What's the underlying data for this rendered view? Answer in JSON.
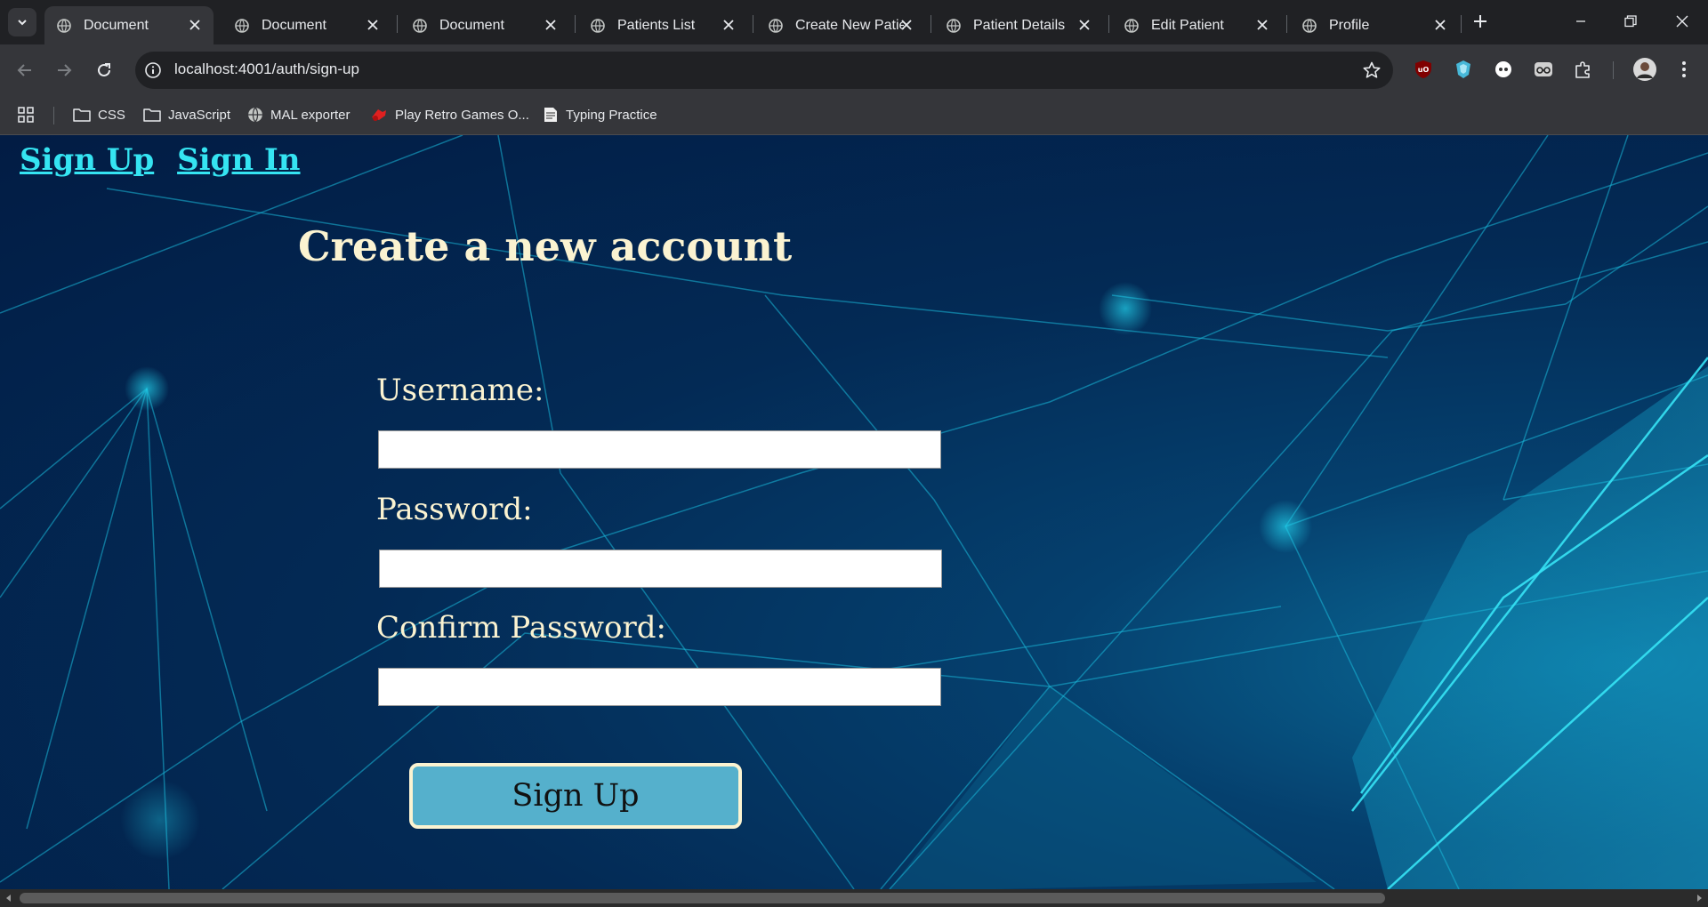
{
  "browser": {
    "tabs": [
      {
        "title": "Document",
        "active": true
      },
      {
        "title": "Document",
        "active": false
      },
      {
        "title": "Document",
        "active": false
      },
      {
        "title": "Patients List",
        "active": false
      },
      {
        "title": "Create New Patie",
        "active": false
      },
      {
        "title": "Patient Details",
        "active": false
      },
      {
        "title": "Edit Patient",
        "active": false
      },
      {
        "title": "Profile",
        "active": false
      }
    ],
    "url": "localhost:4001/auth/sign-up",
    "bookmarks": [
      {
        "label": "CSS",
        "icon": "folder-icon"
      },
      {
        "label": "JavaScript",
        "icon": "folder-icon"
      },
      {
        "label": "MAL exporter",
        "icon": "globe-icon"
      },
      {
        "label": "Play Retro Games O...",
        "icon": "game-icon"
      },
      {
        "label": "Typing Practice",
        "icon": "keyboard-icon"
      }
    ],
    "extensions": [
      "ublock-icon",
      "shield-extension-icon",
      "circle-extension-icon",
      "glasses-extension-icon",
      "puzzle-icon"
    ]
  },
  "page": {
    "nav": {
      "sign_up": "Sign Up",
      "sign_in": "Sign In"
    },
    "title": "Create a new account",
    "form": {
      "username_label": "Username:",
      "username_value": "",
      "password_label": "Password:",
      "password_value": "",
      "confirm_label": "Confirm Password:",
      "confirm_value": "",
      "submit_label": "Sign Up"
    }
  },
  "colors": {
    "accent_link": "#35e4f2",
    "title_text": "#fbf3d1",
    "button_bg": "#55b0cc",
    "background_dark": "#021c44",
    "line_glow": "#22d3ee"
  }
}
